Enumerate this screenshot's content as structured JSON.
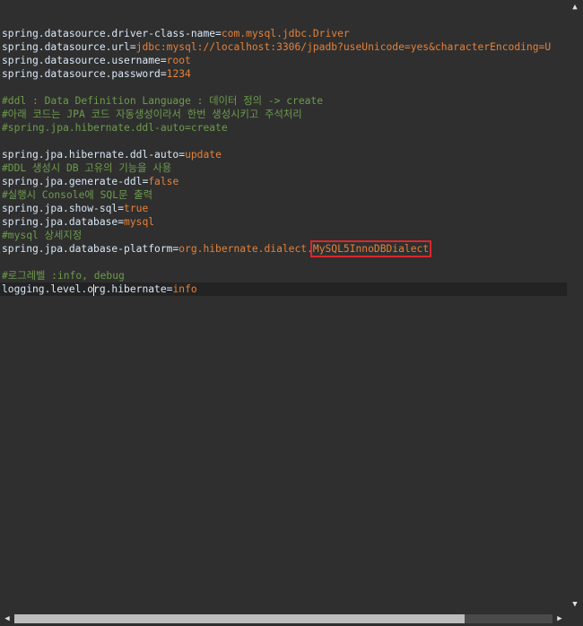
{
  "code": {
    "lines": [
      {
        "key": "spring.datasource.driver-class-name",
        "eq": "=",
        "value": "com.mysql.jdbc.Driver"
      },
      {
        "key": "spring.datasource.url",
        "eq": "=",
        "value": "jdbc:mysql://localhost:3306/jpadb?useUnicode=yes&characterEncoding=U"
      },
      {
        "key": "spring.datasource.username",
        "eq": "=",
        "value": "root"
      },
      {
        "key": "spring.datasource.password",
        "eq": "=",
        "value": "1234"
      },
      {
        "comment": "#ddl : Data Definition Language : 데이터 정의 -> create"
      },
      {
        "comment": "#아래 코드는 JPA 코드 자동생성이라서 한번 생성시키고 주석처리"
      },
      {
        "comment": "#spring.jpa.hibernate.ddl-auto=create"
      },
      {
        "key": "spring.jpa.hibernate.ddl-auto",
        "eq": "=",
        "value": "update"
      },
      {
        "comment": "#DDL 생성시 DB 고유의 기능을 사용"
      },
      {
        "key": "spring.jpa.generate-ddl",
        "eq": "=",
        "value": "false"
      },
      {
        "comment": "#실행시 Console에 SQL문 출력"
      },
      {
        "key": "spring.jpa.show-sql",
        "eq": "=",
        "value": "true"
      },
      {
        "key": "spring.jpa.database",
        "eq": "=",
        "value": "mysql"
      },
      {
        "comment": "#mysql 상세지정"
      },
      {
        "key": "spring.jpa.database-platform",
        "eq": "=",
        "value": "org.hibernate.dialect.",
        "highlight": "MySQL5InnoDBDialect"
      },
      {
        "comment": "#로그레벨 :info, debug"
      },
      {
        "key_a": "logging.level.o",
        "key_b": "rg.hibernate",
        "eq": "=",
        "value": "info"
      }
    ]
  },
  "colors": {
    "background": "#2f2f2f",
    "key": "#d9e8f7",
    "value": "#e5813a",
    "comment": "#6d9c4b",
    "highlight_box": "#d9272d"
  },
  "scrollbar": {
    "up_arrow": "▲",
    "down_arrow": "▼",
    "left_arrow": "◀",
    "right_arrow": "▶"
  }
}
